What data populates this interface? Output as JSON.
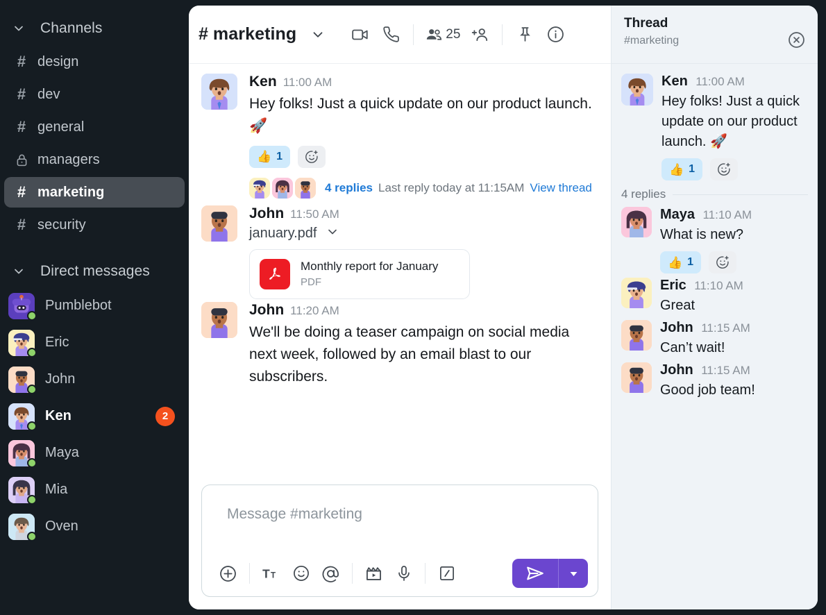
{
  "sidebar": {
    "channels_section": {
      "label": "Channels",
      "icon": "chevron-down-icon"
    },
    "channels": [
      {
        "name": "design",
        "icon": "hash-icon",
        "active": false
      },
      {
        "name": "dev",
        "icon": "hash-icon",
        "active": false
      },
      {
        "name": "general",
        "icon": "hash-icon",
        "active": false
      },
      {
        "name": "managers",
        "icon": "lock-icon",
        "active": false
      },
      {
        "name": "marketing",
        "icon": "hash-icon",
        "active": true
      },
      {
        "name": "security",
        "icon": "hash-icon",
        "active": false
      }
    ],
    "dm_section": {
      "label": "Direct messages",
      "icon": "chevron-down-icon"
    },
    "dms": [
      {
        "name": "Pumblebot",
        "status": "online",
        "badge": ""
      },
      {
        "name": "Eric",
        "status": "online",
        "badge": ""
      },
      {
        "name": "John",
        "status": "online",
        "badge": ""
      },
      {
        "name": "Ken",
        "status": "online",
        "badge": "2"
      },
      {
        "name": "Maya",
        "status": "online",
        "badge": ""
      },
      {
        "name": "Mia",
        "status": "online",
        "badge": ""
      },
      {
        "name": "Oven",
        "status": "online",
        "badge": ""
      }
    ]
  },
  "header": {
    "hash": "#",
    "channel": "marketing",
    "caret_icon": "chevron-down-icon",
    "video_icon": "video-camera-icon",
    "call_icon": "phone-icon",
    "members_icon": "members-icon",
    "members_count": "25",
    "add_member_icon": "add-person-icon",
    "pin_icon": "pin-icon",
    "info_icon": "info-icon"
  },
  "messages": [
    {
      "author": "Ken",
      "time": "11:00 AM",
      "text": "Hey folks! Just a quick update on our product launch. 🚀",
      "reaction": {
        "emoji": "👍",
        "count": "1"
      },
      "add_reaction_icon": "add-reaction-icon",
      "thread": {
        "replies": "4 replies",
        "last": "Last reply today at 11:15AM",
        "view": "View thread"
      }
    },
    {
      "author": "John",
      "time": "11:50 AM",
      "filename": "january.pdf",
      "file_caret_icon": "chevron-down-icon",
      "file": {
        "title": "Monthly report for January",
        "kind": "PDF",
        "icon": "pdf-icon"
      }
    },
    {
      "author": "John",
      "time": "11:20 AM",
      "text": "We'll be doing a teaser campaign on social media next week, followed by an email blast to our subscribers."
    }
  ],
  "composer": {
    "placeholder": "Message #marketing",
    "tools": [
      {
        "name": "add-attachment-icon",
        "label": "+"
      },
      {
        "name": "text-format-icon",
        "label": "Tt"
      },
      {
        "name": "emoji-icon",
        "label": "☺"
      },
      {
        "name": "mention-icon",
        "label": "@"
      },
      {
        "name": "video-clip-icon",
        "label": "clip"
      },
      {
        "name": "microphone-icon",
        "label": "mic"
      },
      {
        "name": "slash-command-icon",
        "label": "/"
      }
    ],
    "send_icon": "send-icon",
    "send_caret_icon": "chevron-down-icon"
  },
  "thread": {
    "title": "Thread",
    "subtitle": "#marketing",
    "close_icon": "close-icon",
    "root": {
      "author": "Ken",
      "time": "11:00 AM",
      "text": "Hey folks! Just a quick update on our product launch. 🚀",
      "reaction": {
        "emoji": "👍",
        "count": "1"
      },
      "add_reaction_icon": "add-reaction-icon"
    },
    "replies_label": "4 replies",
    "replies": [
      {
        "author": "Maya",
        "time": "11:10 AM",
        "text": "What is new?",
        "reaction": {
          "emoji": "👍",
          "count": "1"
        },
        "add_reaction_icon": "add-reaction-icon"
      },
      {
        "author": "Eric",
        "time": "11:10 AM",
        "text": "Great"
      },
      {
        "author": "John",
        "time": "11:15 AM",
        "text": "Can’t wait!"
      },
      {
        "author": "John",
        "time": "11:15 AM",
        "text": "Good job team!"
      }
    ]
  },
  "colors": {
    "sidebar_bg": "#151c22",
    "active_channel": "#474d54",
    "badge": "#f4511e",
    "send_button": "#6b46cf",
    "link": "#1f7ad6",
    "reaction_pill": "#cfeafc",
    "thread_bg": "#eff3f7",
    "pdf_red": "#ed1c24",
    "online": "#8ed36a"
  }
}
